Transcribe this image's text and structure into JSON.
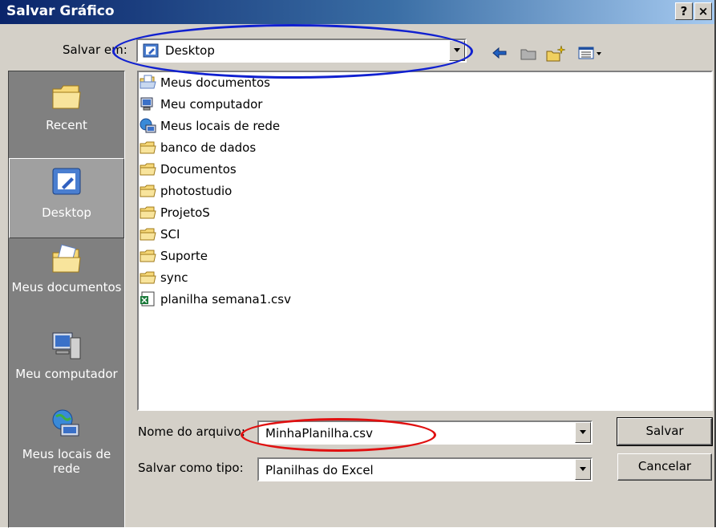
{
  "dialog": {
    "title": "Salvar Gráfico",
    "help_label": "?",
    "close_label": "×"
  },
  "save_in": {
    "label": "Salvar em:",
    "value": "Desktop"
  },
  "places": [
    {
      "label": "Recent"
    },
    {
      "label": "Desktop"
    },
    {
      "label": "Meus documentos"
    },
    {
      "label": "Meu computador"
    },
    {
      "label": "Meus locais de rede"
    }
  ],
  "files": [
    {
      "name": "Meus documentos",
      "icon": "my-documents-icon"
    },
    {
      "name": "Meu computador",
      "icon": "computer-icon"
    },
    {
      "name": "Meus locais de rede",
      "icon": "network-icon"
    },
    {
      "name": "banco de dados",
      "icon": "folder-icon"
    },
    {
      "name": "Documentos",
      "icon": "folder-icon"
    },
    {
      "name": "photostudio",
      "icon": "folder-icon"
    },
    {
      "name": "ProjetoS",
      "icon": "folder-icon"
    },
    {
      "name": "SCI",
      "icon": "folder-icon"
    },
    {
      "name": "Suporte",
      "icon": "folder-icon"
    },
    {
      "name": "sync",
      "icon": "folder-icon"
    },
    {
      "name": "planilha semana1.csv",
      "icon": "excel-file-icon"
    }
  ],
  "file_name": {
    "label": "Nome do arquivo:",
    "value": "MinhaPlanilha.csv"
  },
  "file_type": {
    "label": "Salvar como tipo:",
    "value": "Planilhas do Excel"
  },
  "buttons": {
    "save": "Salvar",
    "cancel": "Cancelar"
  },
  "colors": {
    "title_bar_start": "#0a246a",
    "title_bar_end": "#a6caf0",
    "annotation_blue": "#1020d0",
    "annotation_red": "#e01010",
    "dialog_face": "#d4d0c8",
    "sidebar": "#808080"
  }
}
